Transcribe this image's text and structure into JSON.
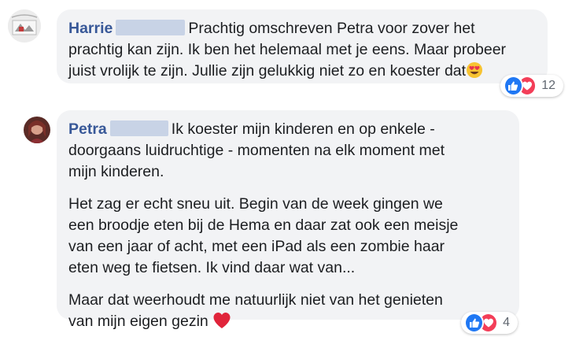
{
  "comments": [
    {
      "author": "Harrie",
      "text": "Prachtig omschreven Petra voor zover het prachtig kan zijn. Ik ben het helemaal met je eens. Maar probeer juist vrolijk te zijn. Jullie zijn gelukkig niet zo en koester dat",
      "line1": "Prachtig omschreven Petra voor zover het",
      "line2": "prachtig kan zijn. Ik ben het helemaal met je eens. Maar probeer",
      "line3": "juist vrolijk te zijn. Jullie zijn gelukkig niet zo en koester dat",
      "trailing_emoji": "heart-eyes-emoji",
      "reaction_icons": [
        "like-icon",
        "love-icon"
      ],
      "reaction_count": "12"
    },
    {
      "author": "Petra",
      "p1_line1": "Ik koester mijn kinderen en op enkele -",
      "p1_line2": "doorgaans luidruchtige - momenten na elk moment met",
      "p1_line3": "mijn kinderen.",
      "p2_line1": "Het zag er echt sneu uit. Begin van de week gingen we",
      "p2_line2": "een broodje eten bij de Hema en daar zat ook een meisje",
      "p2_line3": "van een jaar of acht, met een iPad als een zombie haar",
      "p2_line4": "eten weg te fietsen. Ik vind daar wat van...",
      "p3_line1": "Maar dat weerhoudt me natuurlijk niet van het genieten",
      "p3_line2": "van mijn eigen gezin",
      "trailing_emoji": "red-heart-emoji",
      "reaction_icons": [
        "like-icon",
        "love-icon"
      ],
      "reaction_count": "4"
    }
  ],
  "colors": {
    "author": "#385898",
    "bubble": "#f2f3f5",
    "like": "#2078f4",
    "love": "#f33e58",
    "redaction": "#c8d3e6"
  }
}
